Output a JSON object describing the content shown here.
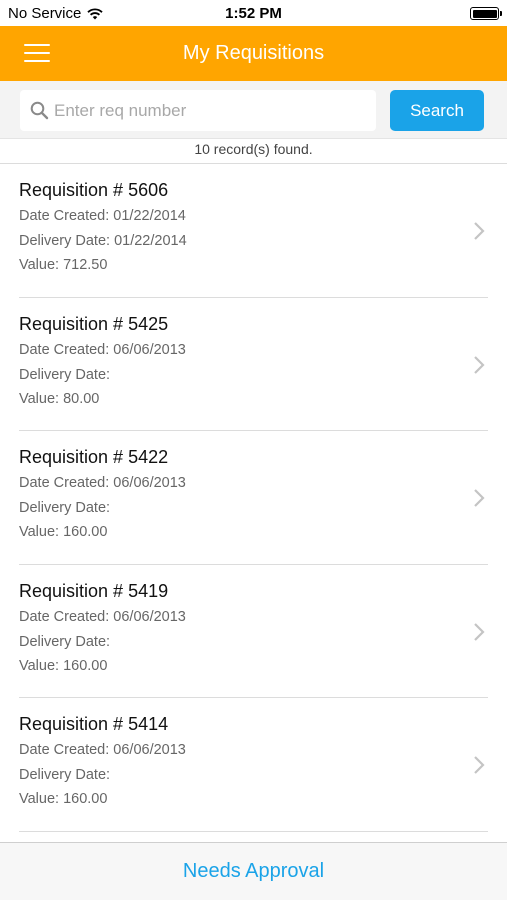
{
  "status_bar": {
    "carrier": "No Service",
    "time": "1:52 PM"
  },
  "nav": {
    "title": "My Requisitions"
  },
  "search": {
    "placeholder": "Enter req number",
    "value": "",
    "button_label": "Search"
  },
  "records_found": "10 record(s) found.",
  "requisitions": [
    {
      "title": "Requisition # 5606",
      "date_created": "Date Created: 01/22/2014",
      "delivery_date": "Delivery Date: 01/22/2014",
      "value": "Value: 712.50"
    },
    {
      "title": "Requisition # 5425",
      "date_created": "Date Created: 06/06/2013",
      "delivery_date": "Delivery Date:",
      "value": "Value: 80.00"
    },
    {
      "title": "Requisition # 5422",
      "date_created": "Date Created: 06/06/2013",
      "delivery_date": "Delivery Date:",
      "value": "Value: 160.00"
    },
    {
      "title": "Requisition # 5419",
      "date_created": "Date Created: 06/06/2013",
      "delivery_date": "Delivery Date:",
      "value": "Value: 160.00"
    },
    {
      "title": "Requisition # 5414",
      "date_created": "Date Created: 06/06/2013",
      "delivery_date": "Delivery Date:",
      "value": "Value: 160.00"
    }
  ],
  "tab_bar": {
    "label": "Needs Approval"
  },
  "colors": {
    "nav_background": "#FFA500",
    "accent": "#1AA3E8"
  },
  "icons": {
    "menu": "hamburger-icon",
    "search": "magnifier-icon",
    "row_arrow": "chevron-right-icon",
    "wifi": "wifi-icon",
    "battery": "battery-icon"
  }
}
